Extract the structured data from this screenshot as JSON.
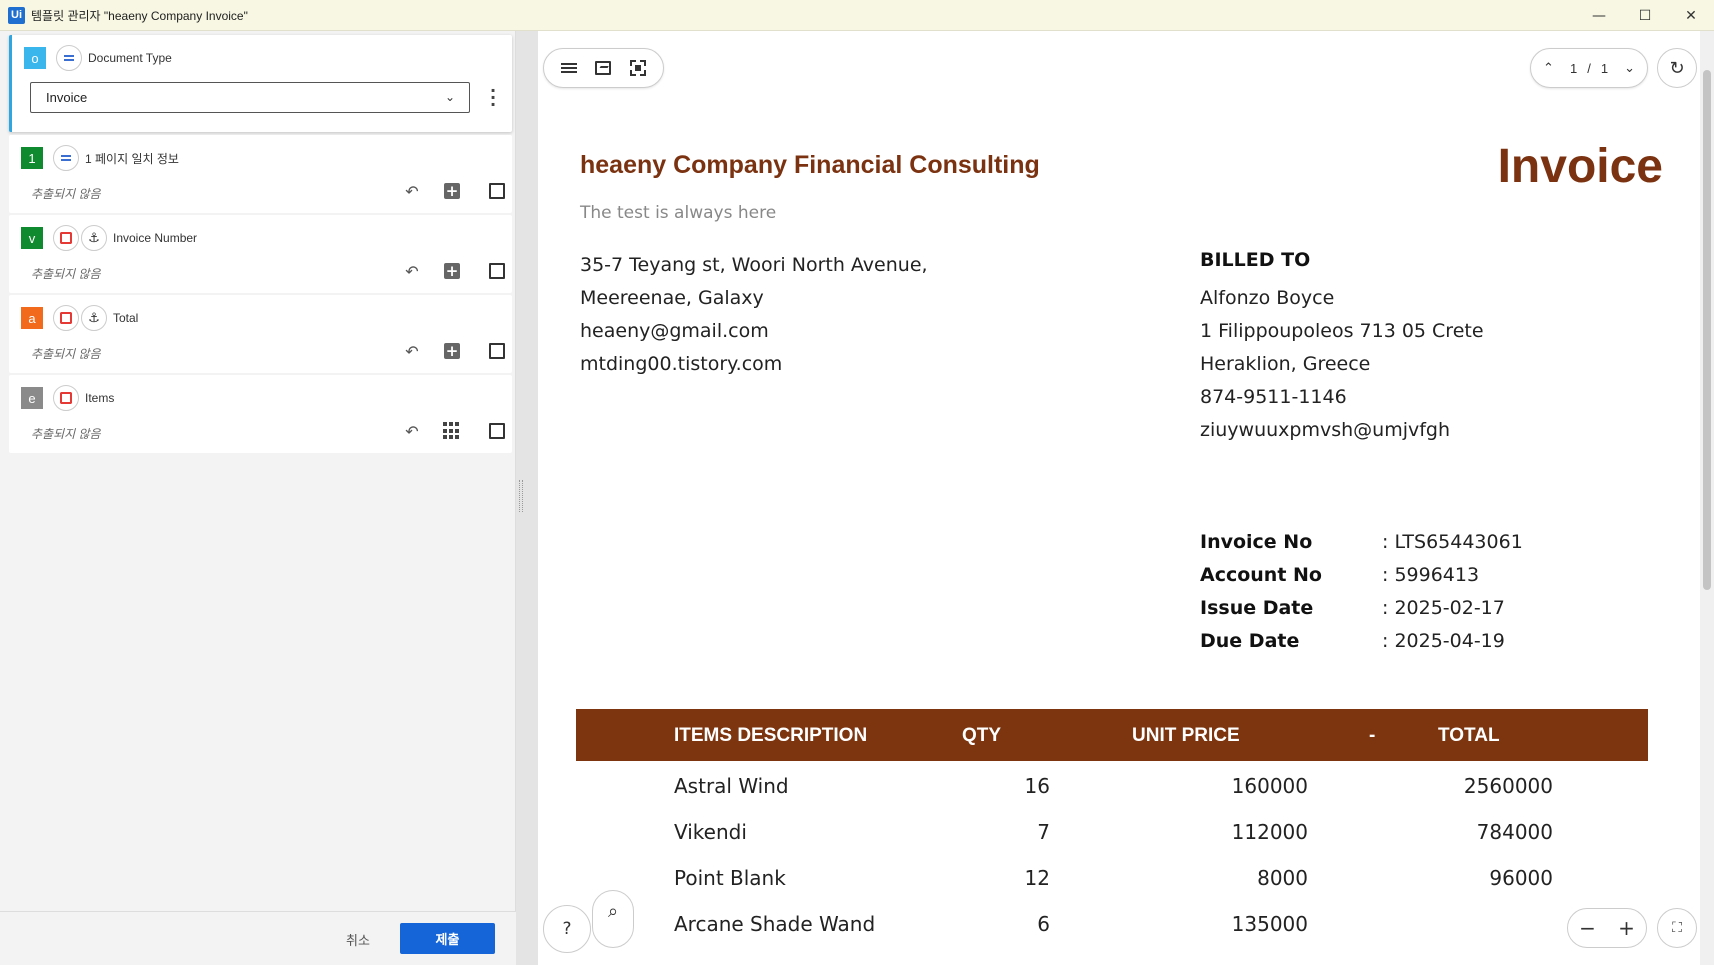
{
  "window": {
    "logo": "Ui",
    "title": "템플릿 관리자 \"heaeny Company Invoice\"",
    "minimize": "—",
    "maximize": "☐",
    "close": "✕"
  },
  "left": {
    "document_type": {
      "badge": "o",
      "badge_color": "#3ab6ec",
      "label": "Document Type",
      "selected": "Invoice"
    },
    "fields": [
      {
        "badge": "1",
        "badge_color": "#0f8a2e",
        "label": "1 페이지 일치 정보",
        "status": "추출되지 않음",
        "icons": [
          "lines-icon"
        ],
        "action": "add-field-icon"
      },
      {
        "badge": "v",
        "badge_color": "#0f8a2e",
        "label": "Invoice Number",
        "status": "추출되지 않음",
        "icons": [
          "region-icon",
          "anchor-icon"
        ],
        "action": "add-field-icon"
      },
      {
        "badge": "a",
        "badge_color": "#f26b1d",
        "label": "Total",
        "status": "추출되지 않음",
        "icons": [
          "region-icon",
          "anchor-icon"
        ],
        "action": "add-field-icon"
      },
      {
        "badge": "e",
        "badge_color": "#8a8a8a",
        "label": "Items",
        "status": "추출되지 않음",
        "icons": [
          "region-icon"
        ],
        "action": "table-grid-icon"
      }
    ],
    "cancel_label": "취소",
    "submit_label": "제출"
  },
  "viewer": {
    "page_current": "1",
    "page_sep": "/",
    "page_total": "1",
    "help_label": "?"
  },
  "invoice": {
    "company": "heaeny Company Financial Consulting",
    "tagline": "The test is always here",
    "title": "Invoice",
    "address": [
      "35-7 Teyang st, Woori North Avenue,",
      "Meereenae, Galaxy",
      "heaeny@gmail.com",
      "mtding00.tistory.com"
    ],
    "billed_heading": "BILLED TO",
    "billed": [
      "Alfonzo Boyce",
      "1 Filippoupoleos 713 05 Crete",
      "Heraklion, Greece",
      "874-9511-1146",
      "ziuywuuxpmvsh@umjvfgh"
    ],
    "meta": [
      {
        "k": "Invoice No",
        "v": ": LTS65443061"
      },
      {
        "k": "Account No",
        "v": ": 5996413"
      },
      {
        "k": "Issue Date",
        "v": ": 2025-02-17"
      },
      {
        "k": "Due Date",
        "v": ": 2025-04-19"
      }
    ],
    "table": {
      "headers": [
        "ITEMS DESCRIPTION",
        "QTY",
        "UNIT PRICE",
        "-",
        "TOTAL"
      ],
      "rows": [
        [
          "Astral Wind",
          "16",
          "160000",
          "2560000"
        ],
        [
          "Vikendi",
          "7",
          "112000",
          "784000"
        ],
        [
          "Point Blank",
          "12",
          "8000",
          "96000"
        ],
        [
          "Arcane Shade Wand",
          "6",
          "135000",
          ""
        ]
      ]
    },
    "brand_color": "#7d3510"
  }
}
